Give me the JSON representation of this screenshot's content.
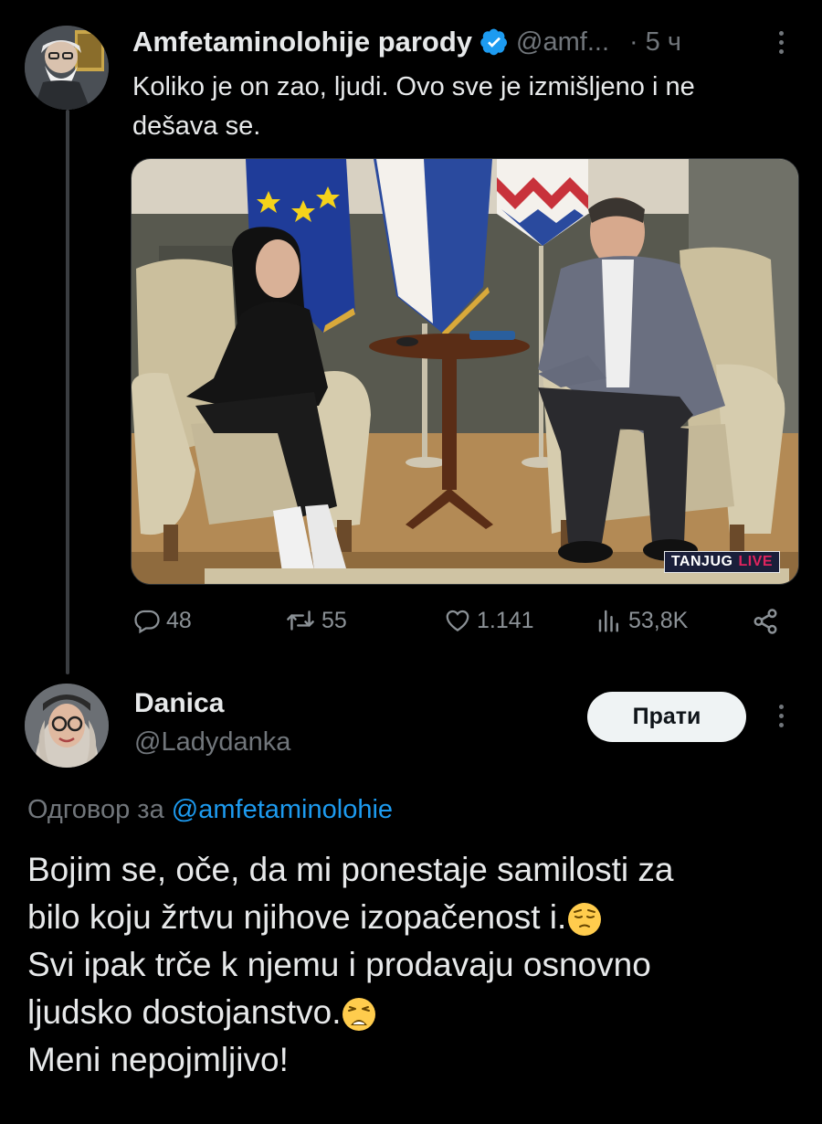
{
  "tweet": {
    "author_name": "Amfetaminolohije parody",
    "handle": "@amf...",
    "separator": "·",
    "time": "5 ч",
    "text_line1": "Koliko je on zao, ljudi. Ovo sve je izmišljeno i ne",
    "text_line2": "dešava se.",
    "media_watermark_main": "TANJUG",
    "media_watermark_live": "LIVE",
    "stats": {
      "replies": "48",
      "retweets": "55",
      "likes": "1.141",
      "views": "53,8K"
    }
  },
  "reply": {
    "author_name": "Danica",
    "handle": "@Ladydanka",
    "follow_label": "Прати",
    "replying_prefix": "Одговор за",
    "replying_to": "@amfetaminolohie",
    "line1": "Bojim se, oče, da mi ponestaje samilosti za",
    "line2": "bilo koju žrtvu njihove izopačenost i.",
    "line3": "Svi ipak trče k njemu i prodavaju osnovno",
    "line4": "ljudsko dostojanstvo.",
    "line5": "Meni nepojmljivo!",
    "emoji1": "pensive-face",
    "emoji2": "weary-face"
  },
  "colors": {
    "background": "#000000",
    "text": "#e7e9ea",
    "muted": "#71767b",
    "link": "#1d9bf0",
    "verified": "#1d9bf0",
    "live_red": "#e0245e"
  }
}
